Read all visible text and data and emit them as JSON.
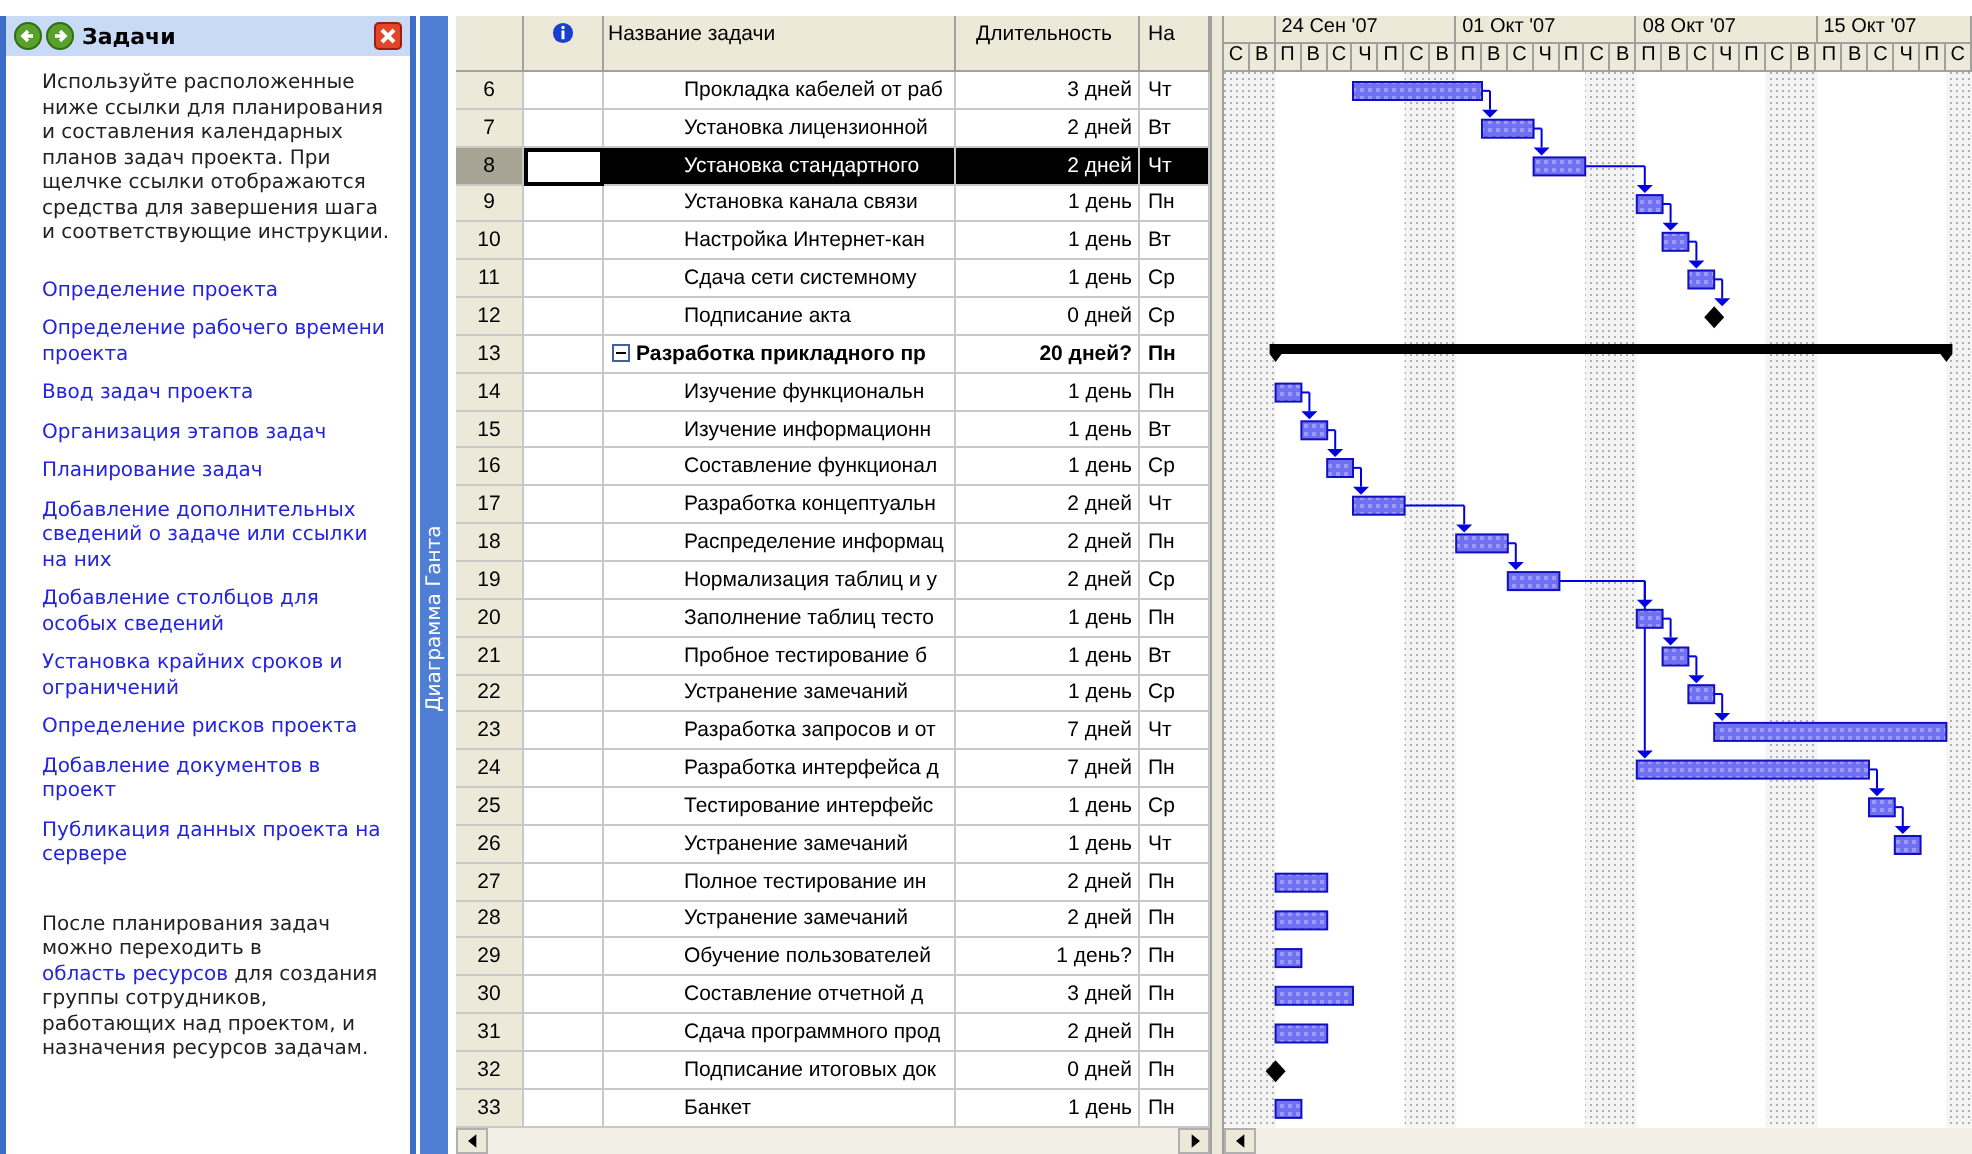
{
  "task_pane": {
    "title": "Задачи",
    "intro": "Используйте расположенные ниже ссылки для планирования и составления календарных планов задач проекта. При щелчке ссылки отображаются средства для завершения шага и соответствующие инструкции.",
    "links": [
      "Определение проекта",
      "Определение рабочего времени проекта",
      "Ввод задач проекта",
      "Организация этапов задач",
      "Планирование задач",
      "Добавление дополнительных сведений о задаче или ссылки на них",
      "Добавление столбцов для особых сведений",
      "Установка крайних сроков и ограничений",
      "Определение рисков проекта",
      "Добавление документов в проект",
      "Публикация данных проекта на сервере"
    ],
    "footer": {
      "before": "После планирования задач можно переходить в ",
      "link": "область ресурсов",
      "after": " для создания группы сотрудников, работающих над проектом, и назначения ресурсов задачам."
    }
  },
  "view_bar": {
    "label": "Диаграмма Ганта"
  },
  "table": {
    "columns": [
      "Название задачи",
      "Длительность",
      "На"
    ],
    "rows": [
      {
        "id": "6",
        "name": "Прокладка кабелей от раб",
        "duration": "3 дней",
        "start": "Чт",
        "kind": "task",
        "selected": false
      },
      {
        "id": "7",
        "name": "Установка лицензионной",
        "duration": "2 дней",
        "start": "Вт",
        "kind": "task",
        "selected": false
      },
      {
        "id": "8",
        "name": "Установка стандартного",
        "duration": "2 дней",
        "start": "Чт",
        "kind": "task",
        "selected": true
      },
      {
        "id": "9",
        "name": "Установка канала связи",
        "duration": "1 день",
        "start": "Пн",
        "kind": "task",
        "selected": false
      },
      {
        "id": "10",
        "name": "Настройка Интернет-кан",
        "duration": "1 день",
        "start": "Вт",
        "kind": "task",
        "selected": false
      },
      {
        "id": "11",
        "name": "Сдача сети системному",
        "duration": "1 день",
        "start": "Ср",
        "kind": "task",
        "selected": false
      },
      {
        "id": "12",
        "name": "Подписание акта",
        "duration": "0 дней",
        "start": "Ср",
        "kind": "task",
        "selected": false
      },
      {
        "id": "13",
        "name": "Разработка прикладного пр",
        "duration": "20 дней?",
        "start": "Пн",
        "kind": "summary",
        "expanded": true,
        "selected": false
      },
      {
        "id": "14",
        "name": "Изучение функциональн",
        "duration": "1 день",
        "start": "Пн",
        "kind": "task",
        "selected": false
      },
      {
        "id": "15",
        "name": "Изучение информационн",
        "duration": "1 день",
        "start": "Вт",
        "kind": "task",
        "selected": false
      },
      {
        "id": "16",
        "name": "Составление функционал",
        "duration": "1 день",
        "start": "Ср",
        "kind": "task",
        "selected": false
      },
      {
        "id": "17",
        "name": "Разработка концептуальн",
        "duration": "2 дней",
        "start": "Чт",
        "kind": "task",
        "selected": false
      },
      {
        "id": "18",
        "name": "Распределение информац",
        "duration": "2 дней",
        "start": "Пн",
        "kind": "task",
        "selected": false
      },
      {
        "id": "19",
        "name": "Нормализация таблиц и у",
        "duration": "2 дней",
        "start": "Ср",
        "kind": "task",
        "selected": false
      },
      {
        "id": "20",
        "name": "Заполнение таблиц тесто",
        "duration": "1 день",
        "start": "Пн",
        "kind": "task",
        "selected": false
      },
      {
        "id": "21",
        "name": "Пробное тестирование б",
        "duration": "1 день",
        "start": "Вт",
        "kind": "task",
        "selected": false
      },
      {
        "id": "22",
        "name": "Устранение замечаний",
        "duration": "1 день",
        "start": "Ср",
        "kind": "task",
        "selected": false
      },
      {
        "id": "23",
        "name": "Разработка запросов и от",
        "duration": "7 дней",
        "start": "Чт",
        "kind": "task",
        "selected": false
      },
      {
        "id": "24",
        "name": "Разработка интерфейса д",
        "duration": "7 дней",
        "start": "Пн",
        "kind": "task",
        "selected": false
      },
      {
        "id": "25",
        "name": "Тестирование интерфейс",
        "duration": "1 день",
        "start": "Ср",
        "kind": "task",
        "selected": false
      },
      {
        "id": "26",
        "name": "Устранение замечаний",
        "duration": "1 день",
        "start": "Чт",
        "kind": "task",
        "selected": false
      },
      {
        "id": "27",
        "name": "Полное тестирование ин",
        "duration": "2 дней",
        "start": "Пн",
        "kind": "task",
        "selected": false
      },
      {
        "id": "28",
        "name": "Устранение замечаний",
        "duration": "2 дней",
        "start": "Пн",
        "kind": "task",
        "selected": false
      },
      {
        "id": "29",
        "name": "Обучение пользователей",
        "duration": "1 день?",
        "start": "Пн",
        "kind": "task",
        "selected": false
      },
      {
        "id": "30",
        "name": "Составление отчетной д",
        "duration": "3 дней",
        "start": "Пн",
        "kind": "task",
        "selected": false
      },
      {
        "id": "31",
        "name": "Сдача программного прод",
        "duration": "2 дней",
        "start": "Пн",
        "kind": "task",
        "selected": false
      },
      {
        "id": "32",
        "name": "Подписание итоговых док",
        "duration": "0 дней",
        "start": "Пн",
        "kind": "task",
        "selected": false
      },
      {
        "id": "33",
        "name": "Банкет",
        "duration": "1 день",
        "start": "Пн",
        "kind": "task",
        "selected": false
      }
    ]
  },
  "timescale": {
    "weeks": [
      "24 Сен '07",
      "01 Окт '07",
      "08 Окт '07",
      "15 Окт '07"
    ],
    "days": [
      "С",
      "В",
      "П",
      "В",
      "С",
      "Ч",
      "П",
      "С",
      "В",
      "П",
      "В",
      "С",
      "Ч",
      "П",
      "С",
      "В",
      "П",
      "В",
      "С",
      "Ч",
      "П",
      "С",
      "В",
      "П",
      "В",
      "С",
      "Ч",
      "П",
      "С"
    ]
  }
}
